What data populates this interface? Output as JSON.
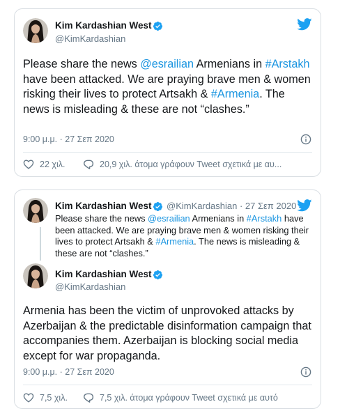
{
  "colors": {
    "link": "#1b95e0",
    "secondary": "#657786",
    "verified": "#1da1f2",
    "twitter_blue": "#1da1f2"
  },
  "icons": [
    "verified-badge-icon",
    "twitter-bird-icon",
    "info-icon",
    "heart-icon",
    "comment-icon"
  ],
  "tweet1": {
    "author_name": "Kim Kardashian West",
    "handle": "@KimKardashian",
    "text_parts": {
      "p1": "Please share the news ",
      "mention": "@esrailian",
      "p2": " Armenians in ",
      "tag1": "#Arstakh",
      "p3": " have been attacked. We are praying brave men & women risking their lives to protect Artsakh & ",
      "tag2": "#Armenia",
      "p4": ". The news is misleading & these are not “clashes.”"
    },
    "timestamp": "9:00 μ.μ. · 27 Σεπ 2020",
    "likes": "22 χιλ.",
    "talking": "20,9 χιλ. άτομα γράφουν Tweet σχετικά με αυ..."
  },
  "tweet2": {
    "quoted": {
      "author_name": "Kim Kardashian West",
      "handle_date": "@KimKardashian · 27 Σεπ 2020",
      "text_parts": {
        "p1": "Please share the news ",
        "mention": "@esrailian",
        "p2": " Armenians in ",
        "tag1": "#Arstakh",
        "p3": " have been attacked. We are praying brave men & women risking their lives to protect Artsakh & ",
        "tag2": "#Armenia",
        "p4": ". The news is misleading & these are not “clashes.”"
      }
    },
    "author_name": "Kim Kardashian West",
    "handle": "@KimKardashian",
    "text": "Armenia has been the victim of unprovoked attacks by Azerbaijan & the predictable disinformation campaign that accompanies them. Azerbaijan is blocking social media except for war propaganda.",
    "timestamp": "9:00 μ.μ. · 27 Σεπ 2020",
    "likes": "7,5 χιλ.",
    "talking": "7,5 χιλ. άτομα γράφουν Tweet σχετικά με αυτό"
  }
}
